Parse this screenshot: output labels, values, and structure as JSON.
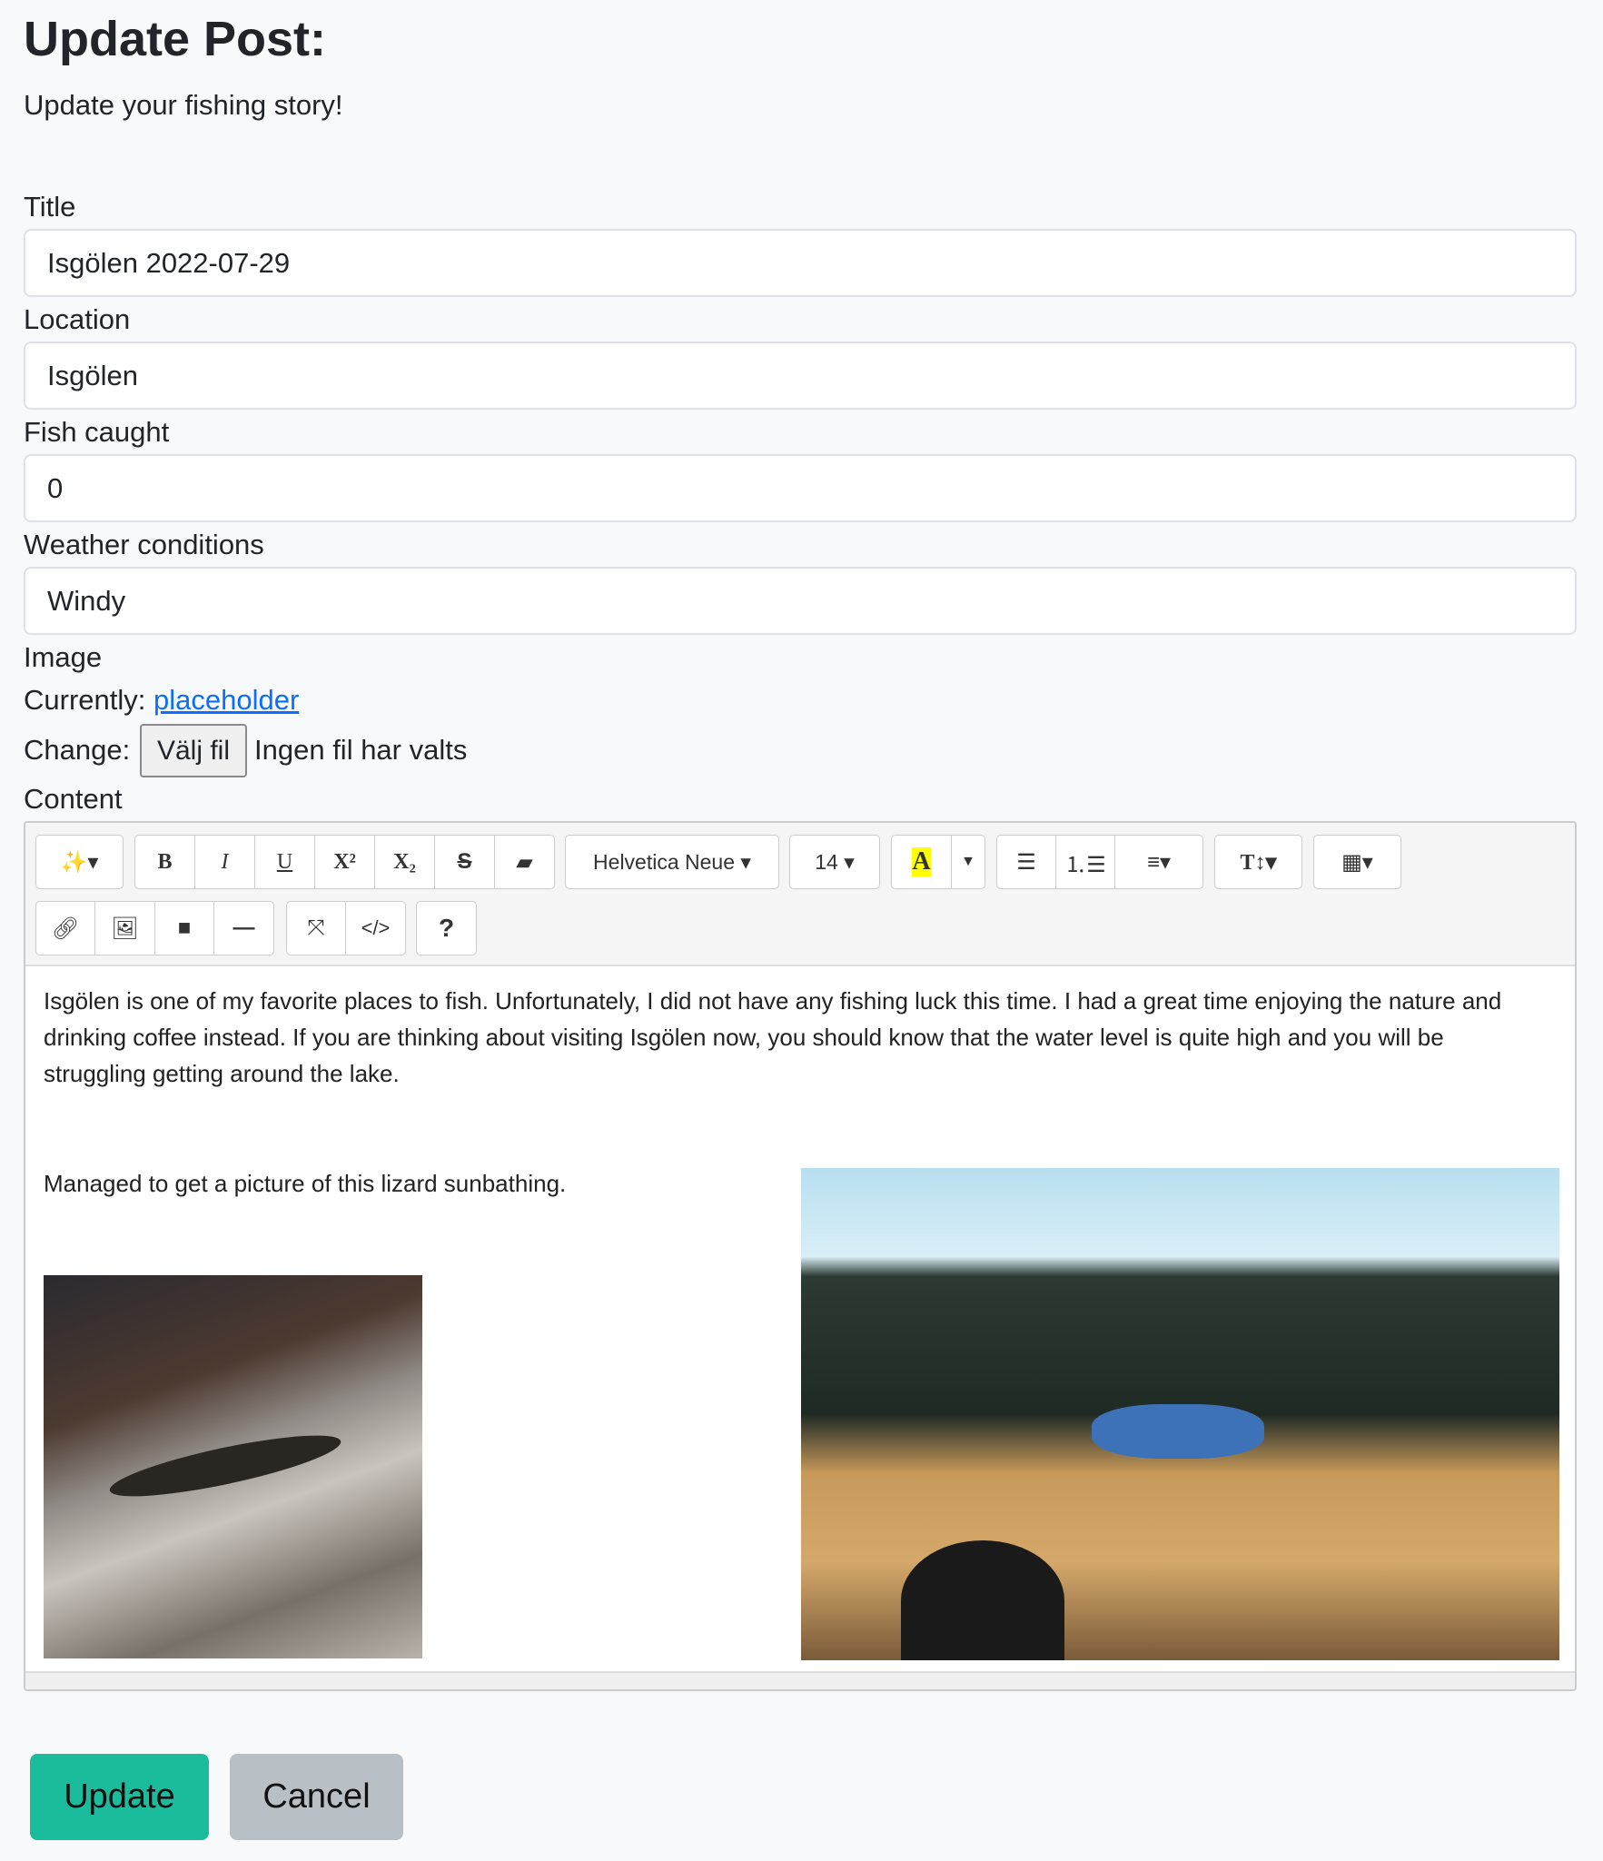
{
  "header": {
    "title": "Update Post:",
    "subtitle": "Update your fishing story!"
  },
  "form": {
    "title_label": "Title",
    "title_value": "Isgölen 2022-07-29",
    "location_label": "Location",
    "location_value": "Isgölen",
    "fish_label": "Fish caught",
    "fish_value": "0",
    "weather_label": "Weather conditions",
    "weather_value": "Windy",
    "image_label": "Image",
    "currently_label": "Currently:",
    "currently_link": "placeholder",
    "change_label": "Change:",
    "file_button": "Välj fil",
    "file_status": "Ingen fil har valts",
    "content_label": "Content"
  },
  "toolbar": {
    "font_name": "Helvetica Neue",
    "font_size": "14",
    "color_letter": "A",
    "highlight_color": "#ffff00",
    "help": "?"
  },
  "content": {
    "paragraph": "Isgölen is one of my favorite places to fish. Unfortunately, I did not have any fishing luck this time. I had a great time enjoying the nature and drinking coffee instead. If you are thinking about visiting Isgölen now, you should know that the water level is quite high and you will be struggling getting around the lake.",
    "caption": "Managed to get a picture of this lizard sunbathing."
  },
  "actions": {
    "update": "Update",
    "cancel": "Cancel",
    "update_color": "#1abc9c",
    "cancel_color": "#b8c0c6"
  }
}
